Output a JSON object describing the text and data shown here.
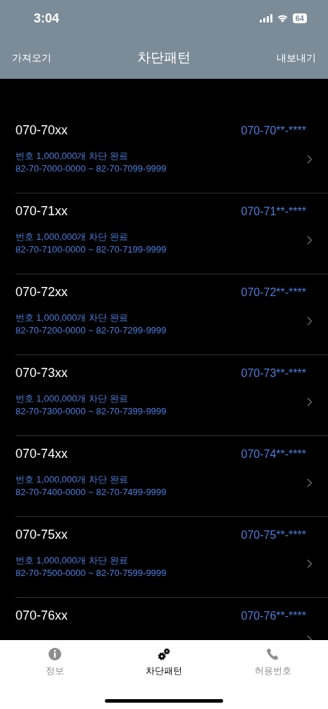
{
  "status_bar": {
    "time": "3:04",
    "battery": "64"
  },
  "nav": {
    "left": "가져오기",
    "title": "차단패턴",
    "right": "내보내기"
  },
  "rows": [
    {
      "title": "070-70xx",
      "pattern": "070-70**-****",
      "lines": [
        "번호 1,000,000개 차단 완료",
        "82-70-7000-0000 ~ 82-70-7099-9999"
      ]
    },
    {
      "title": "070-71xx",
      "pattern": "070-71**-****",
      "lines": [
        "번호 1,000,000개 차단 완료",
        "82-70-7100-0000 ~ 82-70-7199-9999"
      ]
    },
    {
      "title": "070-72xx",
      "pattern": "070-72**-****",
      "lines": [
        "번호 1,000,000개 차단 완료",
        "82-70-7200-0000 ~ 82-70-7299-9999"
      ]
    },
    {
      "title": "070-73xx",
      "pattern": "070-73**-****",
      "lines": [
        "번호 1,000,000개 차단 완료",
        "82-70-7300-0000 ~ 82-70-7399-9999"
      ]
    },
    {
      "title": "070-74xx",
      "pattern": "070-74**-****",
      "lines": [
        "번호 1,000,000개 차단 완료",
        "82-70-7400-0000 ~ 82-70-7499-9999"
      ]
    },
    {
      "title": "070-75xx",
      "pattern": "070-75**-****",
      "lines": [
        "번호 1,000,000개 차단 완료",
        "82-70-7500-0000 ~ 82-70-7599-9999"
      ]
    },
    {
      "title": "070-76xx",
      "pattern": "070-76**-****"
    }
  ],
  "tabs": [
    {
      "label": "정보",
      "kind": "info",
      "selected": false
    },
    {
      "label": "차단패턴",
      "kind": "gears",
      "selected": true
    },
    {
      "label": "허용번호",
      "kind": "phone",
      "selected": false
    }
  ]
}
